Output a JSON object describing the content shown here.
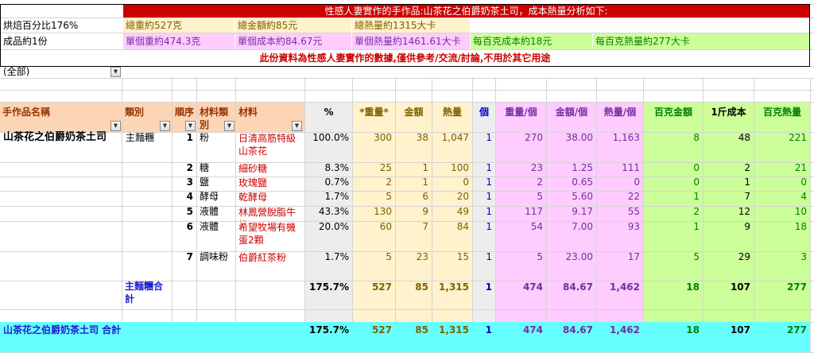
{
  "summary": {
    "title": "性感人妻實作的手作品:山茶花之伯爵奶茶土司，成本熱量分析如下:",
    "row1_label": "烘焙百分比176%",
    "total_weight": "總重約527克",
    "total_cost": "總金額約85元",
    "total_cal": "總熱量約1315大卡",
    "row2_label": "成品約1份",
    "unit_weight": "單個重約474.3克",
    "unit_cost": "單個成本約84.67元",
    "unit_cal": "單個熱量約1461.61大卡",
    "per100_cost": "每百克成本約18元",
    "per100_cal": "每百克熱量約277大卡",
    "disclaimer": "此份資料為性感人妻實作的數據,僅供參考/交流/討論,不用於其它用途"
  },
  "filter_value": "(全部)",
  "colors": {
    "title_bar": "#cc0000",
    "summary_tan": "#fff2cc",
    "pink": "#ffccff",
    "green": "#ccff99",
    "blue": "#0000cc",
    "cyan": "#66ffff",
    "orange": "#fcd5b4",
    "gray": "#ededed"
  },
  "headers": {
    "name": "手作品名稱",
    "category": "類別",
    "order": "順序",
    "mat_cat": "材料類別",
    "material": "材料",
    "pct": "%",
    "weight": "*重量*",
    "amount": "金額",
    "cal": "熱量",
    "count": "個",
    "weight_per": "重量/個",
    "amount_per": "金額/個",
    "cal_per": "熱量/個",
    "per100_amount": "百克金額",
    "cost_jin": "1斤成本",
    "per100_cal": "百克熱量"
  },
  "product_name": "山茶花之伯爵奶茶土司",
  "category_name": "主麵糰",
  "rows": [
    {
      "order": "1",
      "mat_cat": "粉",
      "material": "日清高筋特級山茶花",
      "pct": "100.0%",
      "weight": "300",
      "amount": "38",
      "cal": "1,047",
      "count": "1",
      "weight_per": "270",
      "amount_per": "38.00",
      "cal_per": "1,163",
      "p100_amt": "8",
      "jin": "48",
      "p100_cal": "221"
    },
    {
      "order": "2",
      "mat_cat": "糖",
      "material": "細砂糖",
      "pct": "8.3%",
      "weight": "25",
      "amount": "1",
      "cal": "100",
      "count": "1",
      "weight_per": "23",
      "amount_per": "1.25",
      "cal_per": "111",
      "p100_amt": "0",
      "jin": "2",
      "p100_cal": "21"
    },
    {
      "order": "3",
      "mat_cat": "鹽",
      "material": "玫瑰鹽",
      "pct": "0.7%",
      "weight": "2",
      "amount": "1",
      "cal": "0",
      "count": "1",
      "weight_per": "2",
      "amount_per": "0.65",
      "cal_per": "0",
      "p100_amt": "0",
      "jin": "1",
      "p100_cal": "0"
    },
    {
      "order": "4",
      "mat_cat": "酵母",
      "material": "乾酵母",
      "pct": "1.7%",
      "weight": "5",
      "amount": "6",
      "cal": "20",
      "count": "1",
      "weight_per": "5",
      "amount_per": "5.60",
      "cal_per": "22",
      "p100_amt": "1",
      "jin": "7",
      "p100_cal": "4"
    },
    {
      "order": "5",
      "mat_cat": "液體",
      "material": "林鳳營脫脂牛奶",
      "pct": "43.3%",
      "weight": "130",
      "amount": "9",
      "cal": "49",
      "count": "1",
      "weight_per": "117",
      "amount_per": "9.17",
      "cal_per": "55",
      "p100_amt": "2",
      "jin": "12",
      "p100_cal": "10"
    },
    {
      "order": "6",
      "mat_cat": "液體",
      "material": "希望牧場有機蛋2顆",
      "pct": "20.0%",
      "weight": "60",
      "amount": "7",
      "cal": "84",
      "count": "1",
      "weight_per": "54",
      "amount_per": "7.00",
      "cal_per": "93",
      "p100_amt": "1",
      "jin": "9",
      "p100_cal": "18"
    },
    {
      "order": "7",
      "mat_cat": "調味粉",
      "material": "伯爵紅茶粉",
      "pct": "1.7%",
      "weight": "5",
      "amount": "23",
      "cal": "15",
      "count": "1",
      "weight_per": "5",
      "amount_per": "23.00",
      "cal_per": "17",
      "p100_amt": "5",
      "jin": "29",
      "p100_cal": "3"
    }
  ],
  "subtotal": {
    "label": "主麵糰合計",
    "pct": "175.7%",
    "weight": "527",
    "amount": "85",
    "cal": "1,315",
    "count": "1",
    "weight_per": "474",
    "amount_per": "84.67",
    "cal_per": "1,462",
    "p100_amt": "18",
    "jin": "107",
    "p100_cal": "277"
  },
  "grand_total": {
    "label": "山茶花之伯爵奶茶土司 合計",
    "pct": "175.7%",
    "weight": "527",
    "amount": "85",
    "cal": "1,315",
    "count": "1",
    "weight_per": "474",
    "amount_per": "84.67",
    "cal_per": "1,462",
    "p100_amt": "18",
    "jin": "107",
    "p100_cal": "277"
  }
}
